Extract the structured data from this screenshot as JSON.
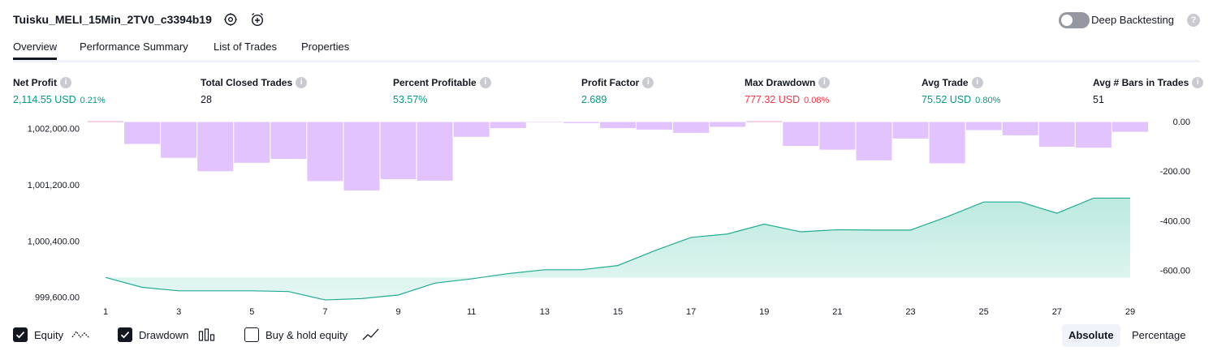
{
  "header": {
    "strategy_name": "Tuisku_MELI_15Min_2TV0_c3394b19",
    "deep_backtesting_label": "Deep Backtesting",
    "deep_backtesting_enabled": false,
    "icons": [
      "settings-icon",
      "add-alert-icon",
      "help-icon"
    ]
  },
  "tabs": [
    "Overview",
    "Performance Summary",
    "List of Trades",
    "Properties"
  ],
  "active_tab": "Overview",
  "metrics": [
    {
      "label": "Net Profit",
      "value": "2,114.55 USD",
      "pct": "0.21%",
      "color": "green"
    },
    {
      "label": "Total Closed Trades",
      "value": "28",
      "pct": "",
      "color": "dark"
    },
    {
      "label": "Percent Profitable",
      "value": "53.57%",
      "pct": "",
      "color": "green"
    },
    {
      "label": "Profit Factor",
      "value": "2.689",
      "pct": "",
      "color": "green"
    },
    {
      "label": "Max Drawdown",
      "value": "777.32 USD",
      "pct": "0.08%",
      "color": "red"
    },
    {
      "label": "Avg Trade",
      "value": "75.52 USD",
      "pct": "0.80%",
      "color": "green"
    },
    {
      "label": "Avg # Bars in Trades",
      "value": "51",
      "pct": "",
      "color": "dark"
    }
  ],
  "legend": {
    "equity": {
      "label": "Equity",
      "checked": true
    },
    "drawdown": {
      "label": "Drawdown",
      "checked": true
    },
    "buy_hold": {
      "label": "Buy & hold equity",
      "checked": false
    }
  },
  "view_mode": {
    "options": [
      "Absolute",
      "Percentage"
    ],
    "selected": "Absolute"
  },
  "colors": {
    "equity_line": "#22ab94",
    "equity_fill": "#b8e8dd",
    "equity_loss_line": "#f23645",
    "equity_loss_fill": "#fbc4c8",
    "drawdown_bar": "#dfbdfd",
    "text": "#131722",
    "positive": "#089981",
    "negative": "#f23645"
  },
  "chart_data": {
    "type": "area",
    "x": [
      1,
      2,
      3,
      4,
      5,
      6,
      7,
      8,
      9,
      10,
      11,
      12,
      13,
      14,
      15,
      16,
      17,
      18,
      19,
      20,
      21,
      22,
      23,
      24,
      25,
      26,
      27,
      28,
      29
    ],
    "x_ticks": [
      1,
      3,
      5,
      7,
      9,
      11,
      13,
      15,
      17,
      19,
      21,
      23,
      25,
      27,
      29
    ],
    "series": [
      {
        "axis": "left",
        "kind": "line-area",
        "values": [
          999880,
          999740,
          999690,
          999690,
          999690,
          999680,
          999560,
          999580,
          999630,
          999800,
          999860,
          999935,
          999990,
          999990,
          1000050,
          1000260,
          1000450,
          1000500,
          1000640,
          1000530,
          1000560,
          1000555,
          1000555,
          1000745,
          1000955,
          1000955,
          1000795,
          1001010,
          1001010
        ]
      },
      {
        "axis": "right",
        "kind": "bar",
        "values": [
          0,
          -92,
          -148,
          -202,
          -168,
          -152,
          -242,
          -280,
          -234,
          -240,
          -63,
          -28,
          -5,
          -8,
          -28,
          -34,
          -47,
          -23,
          0,
          -100,
          -115,
          -158,
          -70,
          -170,
          -36,
          -57,
          -103,
          -107,
          -43
        ]
      }
    ],
    "y_left_ticks": [
      "1,002,000.00",
      "1,001,200.00",
      "1,000,400.00",
      "999,600.00"
    ],
    "y_left_tick_values": [
      1002000,
      1001200,
      1000400,
      999600
    ],
    "y_left_range": [
      999330,
      1002100
    ],
    "y_right_ticks": [
      "0.00",
      "-200.00",
      "-400.00",
      "-600.00"
    ],
    "y_right_tick_values": [
      0,
      -200,
      -400,
      -600
    ],
    "y_right_range": [
      -785,
      0
    ],
    "equity_baseline": 999880
  }
}
